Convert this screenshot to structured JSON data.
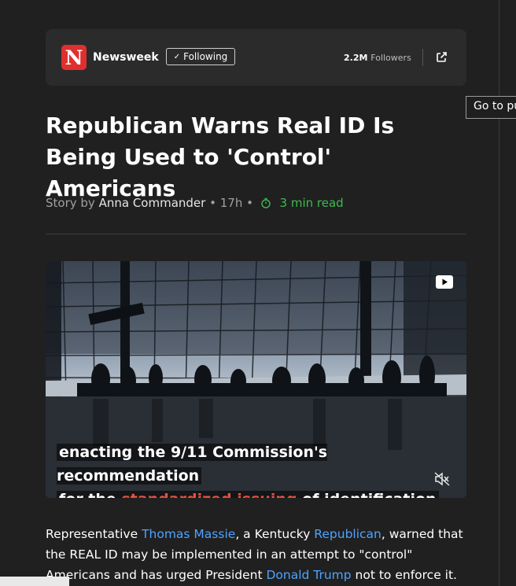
{
  "publisher": {
    "logo_letter": "N",
    "name": "Newsweek",
    "follow_label": "Following",
    "followers_count": "2.2M",
    "followers_label": "Followers"
  },
  "article": {
    "title": "Republican Warns Real ID Is Being Used to 'Control' Americans",
    "byline_prefix": "Story by",
    "author": "Anna Commander",
    "age": "17h",
    "read_time": "3 min read",
    "video": {
      "caption_line1": "enacting the 9/11 Commission's recommendation",
      "caption_line2_pre": "for the",
      "caption_line2_highlight": "standardized issuing",
      "caption_line2_post": "of identification"
    },
    "body": {
      "t1": "Representative ",
      "l1": "Thomas Massie",
      "t2": ", a Kentucky ",
      "l2": "Republican",
      "t3": ", warned that the REAL ID may be implemented in an attempt to \"control\" Americans and has urged President ",
      "l3": "Donald Trump",
      "t4": " not to enforce it."
    }
  },
  "tooltip": {
    "text": "Go to publisher"
  },
  "colors": {
    "background": "#202020",
    "card": "#2b2b2b",
    "link": "#4ea3ff",
    "read_time": "#3fb950",
    "logo": "#e02f2f",
    "caption_highlight": "#e5533d"
  }
}
